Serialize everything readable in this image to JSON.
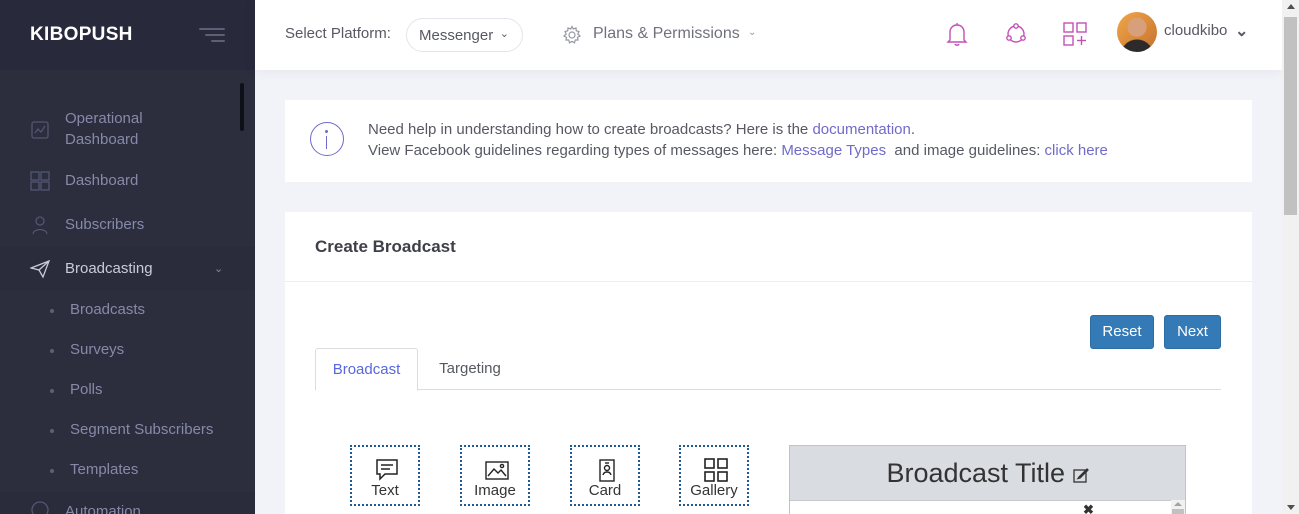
{
  "brand": {
    "name": "KIBOPUSH"
  },
  "sidebar": {
    "items": [
      {
        "label": "Operational Dashboard",
        "icon": "chart-board-icon"
      },
      {
        "label": "Dashboard",
        "icon": "grid-icon"
      },
      {
        "label": "Subscribers",
        "icon": "user-icon"
      },
      {
        "label": "Broadcasting",
        "icon": "paper-plane-icon",
        "expanded": true
      },
      {
        "label": "Automation",
        "icon": "automation-icon"
      }
    ],
    "subitems": [
      {
        "label": "Broadcasts"
      },
      {
        "label": "Surveys"
      },
      {
        "label": "Polls"
      },
      {
        "label": "Segment Subscribers"
      },
      {
        "label": "Templates"
      }
    ]
  },
  "topbar": {
    "platform_label": "Select Platform:",
    "platform_value": "Messenger",
    "plans_label": "Plans & Permissions",
    "username": "cloudkibo",
    "icons": [
      "bell-icon",
      "network-icon",
      "add-apps-icon"
    ]
  },
  "info": {
    "line1_prefix": "Need help in understanding how to create broadcasts? Here is the ",
    "line1_link": "documentation",
    "line1_suffix": ".",
    "line2_prefix": "View Facebook guidelines regarding types of messages here: ",
    "line2_link": "Message Types",
    "line2_middle": "  and image guidelines: ",
    "line2_link2": "click here"
  },
  "card": {
    "title": "Create Broadcast",
    "reset_label": "Reset",
    "next_label": "Next",
    "tabs": [
      {
        "label": "Broadcast",
        "active": true
      },
      {
        "label": "Targeting",
        "active": false
      }
    ],
    "components": [
      {
        "label": "Text",
        "icon": "message-icon"
      },
      {
        "label": "Image",
        "icon": "image-icon"
      },
      {
        "label": "Card",
        "icon": "id-card-icon"
      },
      {
        "label": "Gallery",
        "icon": "gallery-grid-icon"
      }
    ],
    "preview_title": "Broadcast Title"
  },
  "colors": {
    "sidebar_bg": "#2c2e3e",
    "accent": "#716aca",
    "link": "#716aca",
    "button": "#337ab7",
    "topbar_icon": "#c54fb5"
  }
}
